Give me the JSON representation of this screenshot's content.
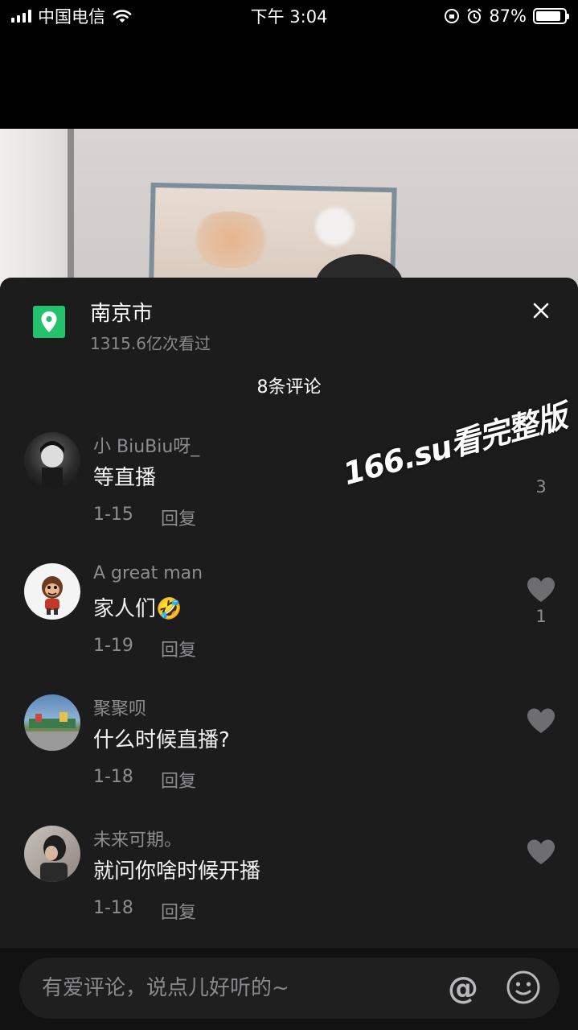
{
  "status_bar": {
    "carrier": "中国电信",
    "time": "下午 3:04",
    "battery": "87%",
    "battery_level": 0.87
  },
  "location": {
    "name": "南京市",
    "views": "1315.6亿次看过"
  },
  "comments_header": "8条评论",
  "comments": [
    {
      "user": "小 BiuBiu呀_",
      "text": "等直播",
      "date": "1-15",
      "reply": "回复",
      "likes": "3"
    },
    {
      "user": "A great man",
      "text": "家人们🤣",
      "date": "1-19",
      "reply": "回复",
      "likes": "1"
    },
    {
      "user": "聚聚呗",
      "text": "什么时候直播?",
      "date": "1-18",
      "reply": "回复",
      "likes": ""
    },
    {
      "user": "未来可期。",
      "text": "就问你啥时候开播",
      "date": "1-18",
      "reply": "回复",
      "likes": ""
    }
  ],
  "watermark": "166.su看完整版",
  "input": {
    "placeholder": "有爱评论，说点儿好听的~"
  },
  "colors": {
    "sheet_bg": "#1c1c1d",
    "location_icon": "#25c26e",
    "muted_text": "#8d8d90"
  }
}
